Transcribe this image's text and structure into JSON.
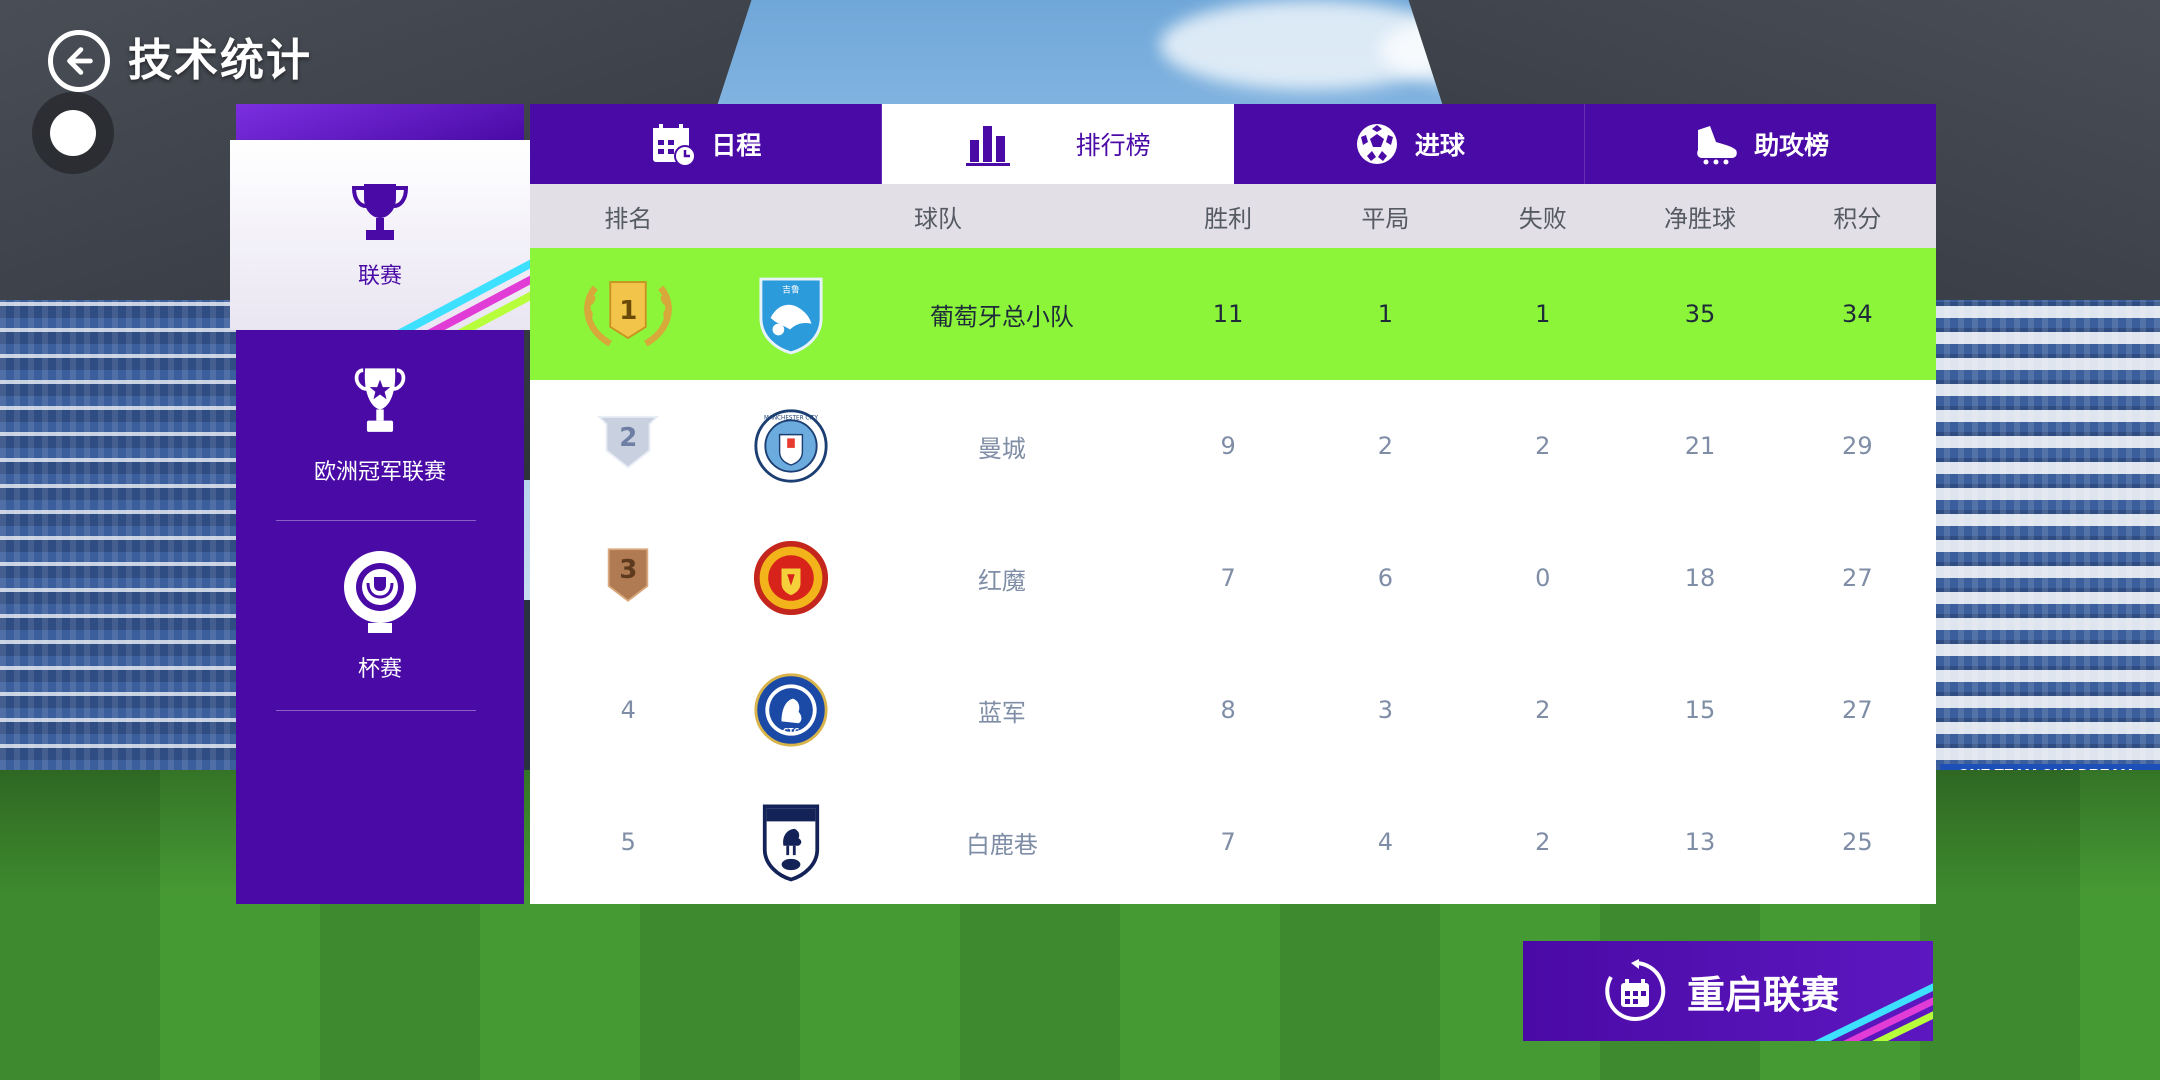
{
  "header": {
    "title": "技术统计"
  },
  "sidebar": {
    "items": [
      {
        "label": "联赛",
        "icon": "trophy-icon",
        "active": true
      },
      {
        "label": "欧洲冠军联赛",
        "icon": "champions-cup-icon",
        "active": false
      },
      {
        "label": "杯赛",
        "icon": "cup-wreath-icon",
        "active": false
      }
    ]
  },
  "tabs": [
    {
      "label": "日程",
      "icon": "calendar-clock-icon",
      "active": false
    },
    {
      "label": "排行榜",
      "icon": "bar-chart-icon",
      "active": true
    },
    {
      "label": "进球",
      "icon": "football-icon",
      "active": false
    },
    {
      "label": "助攻榜",
      "icon": "boot-icon",
      "active": false
    }
  ],
  "table": {
    "columns": [
      "排名",
      "球队",
      "胜利",
      "平局",
      "失败",
      "净胜球",
      "积分"
    ],
    "rows": [
      {
        "rank": "1",
        "team": "葡萄牙总小队",
        "w": "11",
        "d": "1",
        "l": "1",
        "gd": "35",
        "pts": "34",
        "badge": "gold-wreath"
      },
      {
        "rank": "2",
        "team": "曼城",
        "w": "9",
        "d": "2",
        "l": "2",
        "gd": "21",
        "pts": "29",
        "badge": "silver"
      },
      {
        "rank": "3",
        "team": "红魔",
        "w": "7",
        "d": "6",
        "l": "0",
        "gd": "18",
        "pts": "27",
        "badge": "bronze"
      },
      {
        "rank": "4",
        "team": "蓝军",
        "w": "8",
        "d": "3",
        "l": "2",
        "gd": "15",
        "pts": "27",
        "badge": ""
      },
      {
        "rank": "5",
        "team": "白鹿巷",
        "w": "7",
        "d": "4",
        "l": "2",
        "gd": "13",
        "pts": "25",
        "badge": ""
      }
    ]
  },
  "logos": {
    "team1_text": "吉鲁",
    "team2_text": "MANCHESTER CITY",
    "team4_text": "CTC"
  },
  "restart_button": {
    "label": "重启联赛",
    "icon": "calendar-restart-icon"
  },
  "background": {
    "ad_text": "ONE TEAM ONE DREAM"
  },
  "colors": {
    "primary_purple": "#4a0aa6",
    "highlight_row": "#8cf53a",
    "header_row": "#e2e0e6"
  }
}
